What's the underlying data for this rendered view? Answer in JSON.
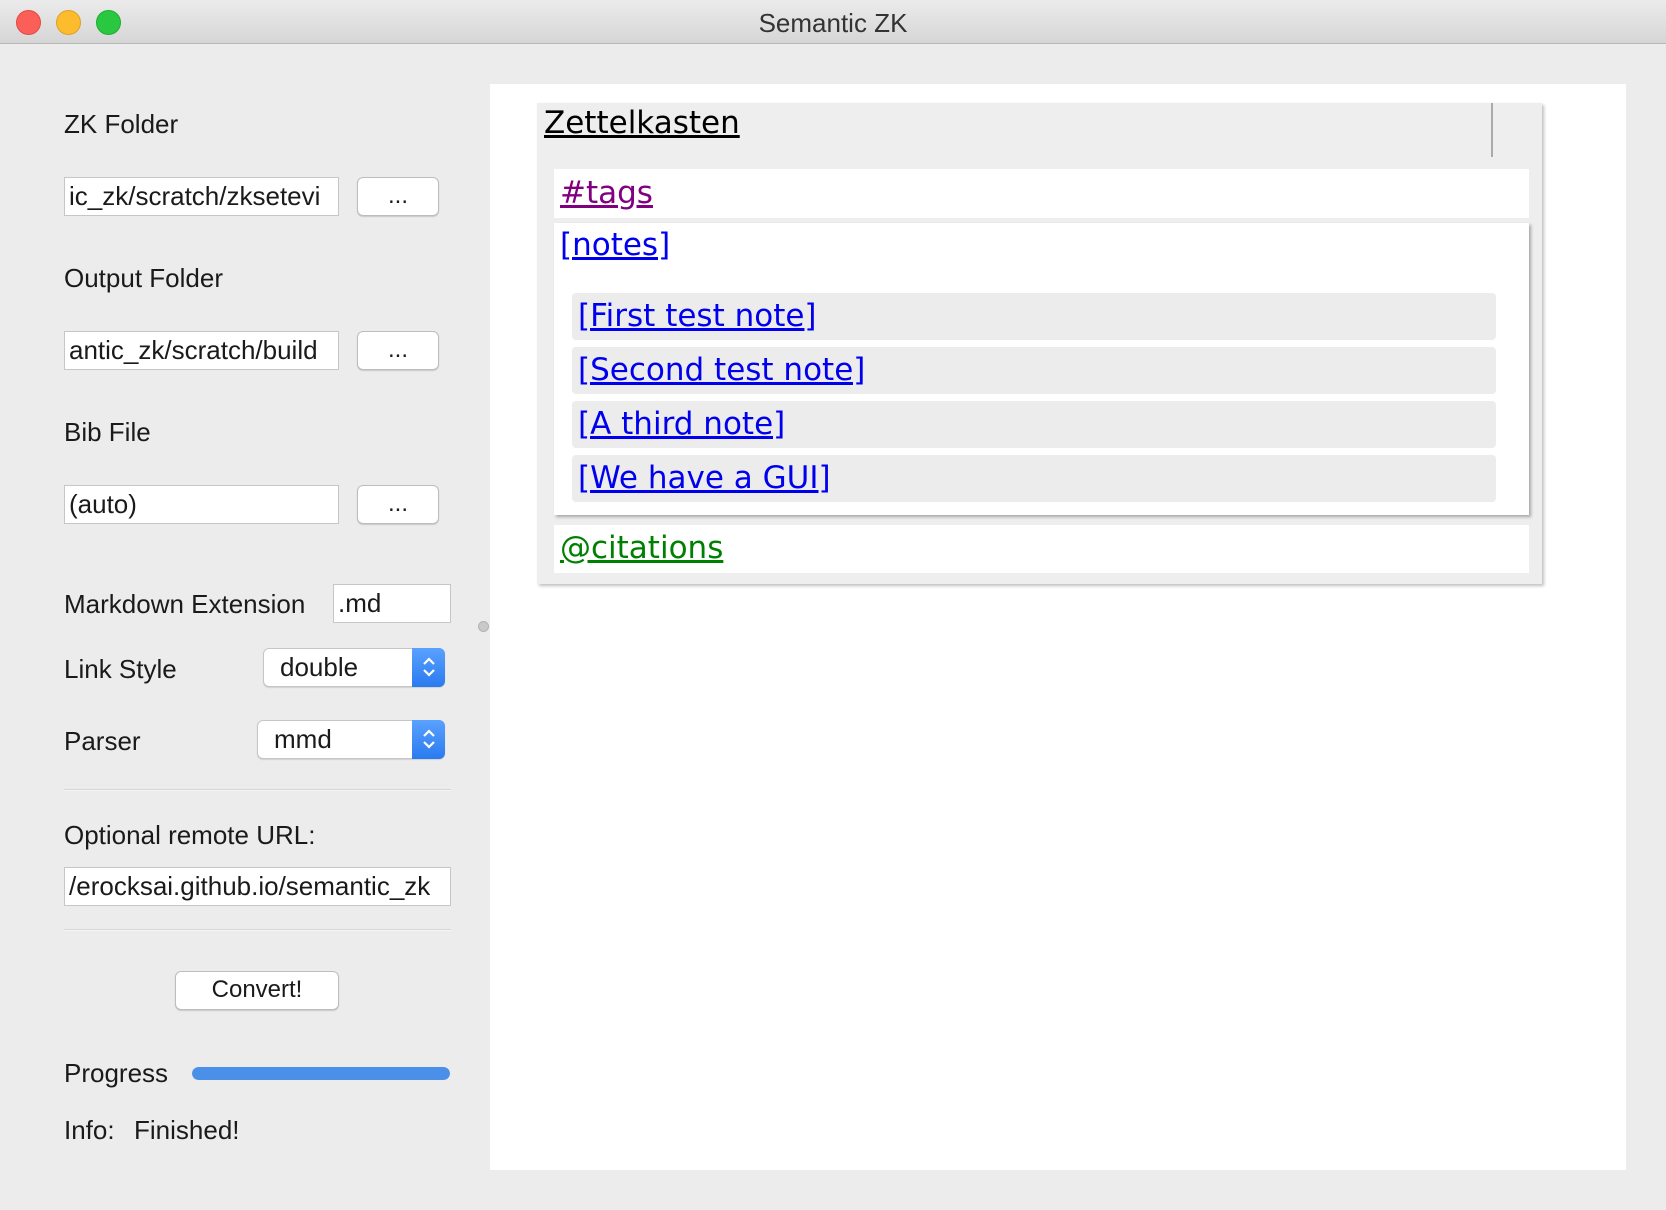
{
  "window": {
    "title": "Semantic ZK"
  },
  "left": {
    "zk_folder": {
      "label": "ZK Folder",
      "value": "ic_zk/scratch/zksetevi",
      "browse": "..."
    },
    "output_folder": {
      "label": "Output Folder",
      "value": "antic_zk/scratch/build",
      "browse": "..."
    },
    "bib_file": {
      "label": "Bib File",
      "value": "(auto)",
      "browse": "..."
    },
    "markdown_ext": {
      "label": "Markdown Extension",
      "value": ".md"
    },
    "link_style": {
      "label": "Link Style",
      "selected": "double"
    },
    "parser": {
      "label": "Parser",
      "selected": "mmd"
    },
    "remote_url": {
      "label": "Optional remote URL:",
      "value": "erocksai.github.io/semantic_zk/"
    },
    "convert": "Convert!",
    "progress": {
      "label": "Progress",
      "percent": 100
    },
    "info": {
      "label": "Info:",
      "value": "Finished!"
    }
  },
  "zk": {
    "title": "Zettelkasten",
    "tags": "#tags",
    "notes_header": "[notes]",
    "notes": [
      "[First test note]",
      "[Second test note]",
      "[A third note]",
      "[We have a GUI]"
    ],
    "citations": "@citations"
  },
  "colors": {
    "tags_link": "#800080",
    "notes_link": "#0000ee",
    "citations_link": "#008000",
    "accent": "#4a90e8"
  }
}
